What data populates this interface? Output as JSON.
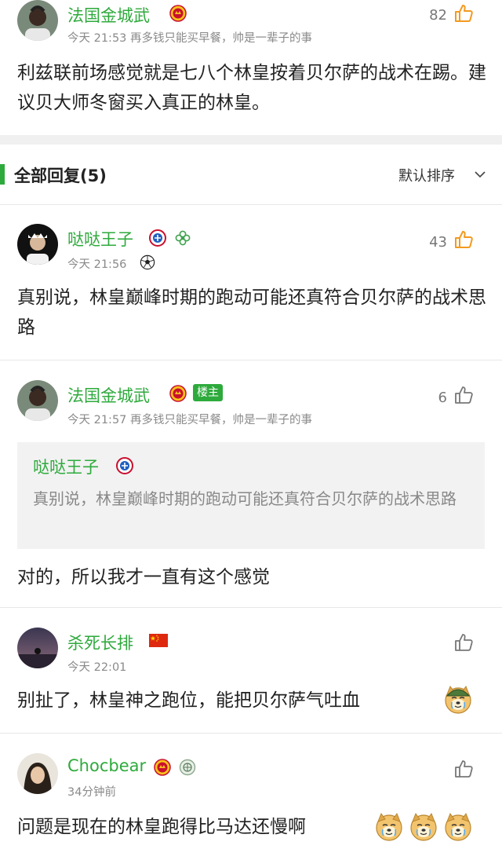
{
  "main_post": {
    "username": "法国金城武",
    "meta": "今天 21:53  再多钱只能买早餐，帅是一辈子的事",
    "likes": "82",
    "content": "利兹联前场感觉就是七八个林皇按着贝尔萨的战术在踢。建议贝大师冬窗买入真正的林皇。"
  },
  "replies_header": {
    "title": "全部回复(5)",
    "sort_label": "默认排序"
  },
  "replies": [
    {
      "username": "哒哒王子",
      "meta": "今天 21:56",
      "likes": "43",
      "content": "真别说，林皇巅峰时期的跑动可能还真符合贝尔萨的战术思路"
    },
    {
      "username": "法国金城武",
      "op_tag": "楼主",
      "meta": "今天 21:57  再多钱只能买早餐，帅是一辈子的事",
      "likes": "6",
      "quote_username": "哒哒王子",
      "quote_text": "真别说，林皇巅峰时期的跑动可能还真符合贝尔萨的战术思路",
      "content": "对的，所以我才一直有这个感觉"
    },
    {
      "username": "杀死长排",
      "meta": "今天 22:01",
      "content": "别扯了，林皇神之跑位，能把贝尔萨气吐血"
    },
    {
      "username": "Chocbear",
      "meta": "34分钟前",
      "content": "问题是现在的林皇跑得比马达还慢啊"
    }
  ],
  "icons": {
    "like": "thumbs-up-icon",
    "sort_chevron": "chevron-down-icon",
    "club_badge_red": "manchester-united-badge-icon",
    "club_badge_bayern": "bayern-badge-icon",
    "football": "football-icon",
    "china_flag": "china-flag-icon",
    "dog_emoji": "doge-emoji-icon"
  },
  "colors": {
    "username_green": "#2eaa3c",
    "meta_gray": "#8a8a8a",
    "separator": "#f0f0f0"
  }
}
